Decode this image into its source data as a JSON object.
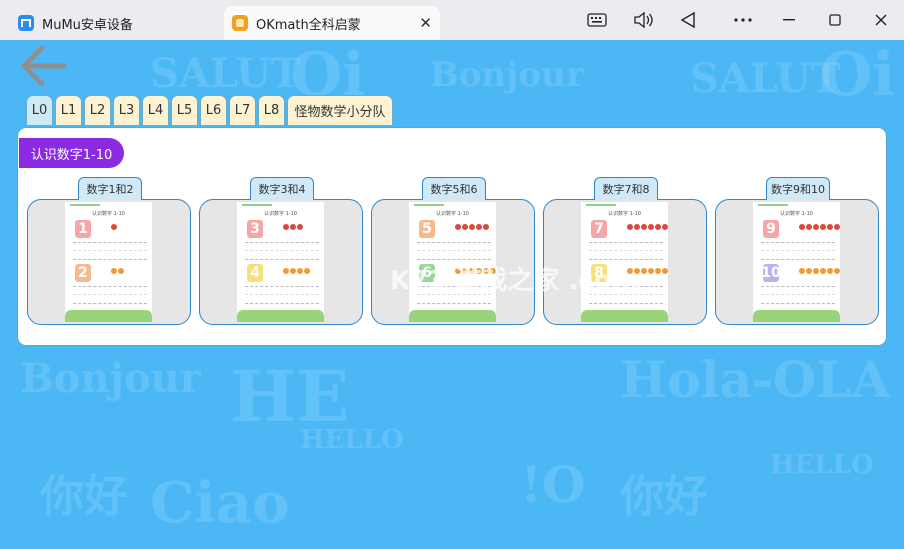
{
  "window": {
    "tabs": [
      {
        "title": "MuMu安卓设备",
        "active": false
      },
      {
        "title": "OKmath全科启蒙",
        "active": true
      }
    ],
    "controls": [
      "keyboard-icon",
      "volume-icon",
      "back-triangle-icon",
      "more-icon",
      "minimize-icon",
      "maximize-icon",
      "close-icon"
    ],
    "close_glyph": "✕"
  },
  "levels": [
    "L0",
    "L1",
    "L2",
    "L3",
    "L4",
    "L5",
    "L6",
    "L7",
    "L8",
    "怪物数学小分队"
  ],
  "active_level": "L0",
  "section": {
    "title": "认识数字1-10",
    "color": "#8a2be2"
  },
  "cards": [
    {
      "label": "数字1和2",
      "sheet_title": "认识数字 1-10",
      "numbers": [
        "1",
        "2"
      ],
      "colors": [
        "#f6a6a6",
        "#f8b890"
      ]
    },
    {
      "label": "数字3和4",
      "sheet_title": "认识数字 1-10",
      "numbers": [
        "3",
        "4"
      ],
      "colors": [
        "#f6a6a6",
        "#f7e07a"
      ]
    },
    {
      "label": "数字5和6",
      "sheet_title": "认识数字 1-10",
      "numbers": [
        "5",
        "6"
      ],
      "colors": [
        "#f8b890",
        "#9bd79b"
      ]
    },
    {
      "label": "数字7和8",
      "sheet_title": "认识数字 1-10",
      "numbers": [
        "7",
        "8"
      ],
      "colors": [
        "#f6a6a6",
        "#f7e07a"
      ]
    },
    {
      "label": "数字9和10",
      "sheet_title": "认识数字 1-10",
      "numbers": [
        "9",
        "10"
      ],
      "colors": [
        "#f6a6a6",
        "#b9b3ee"
      ]
    }
  ],
  "watermark": "K73 游戏之家 .com",
  "accent": "#4bb8f5"
}
